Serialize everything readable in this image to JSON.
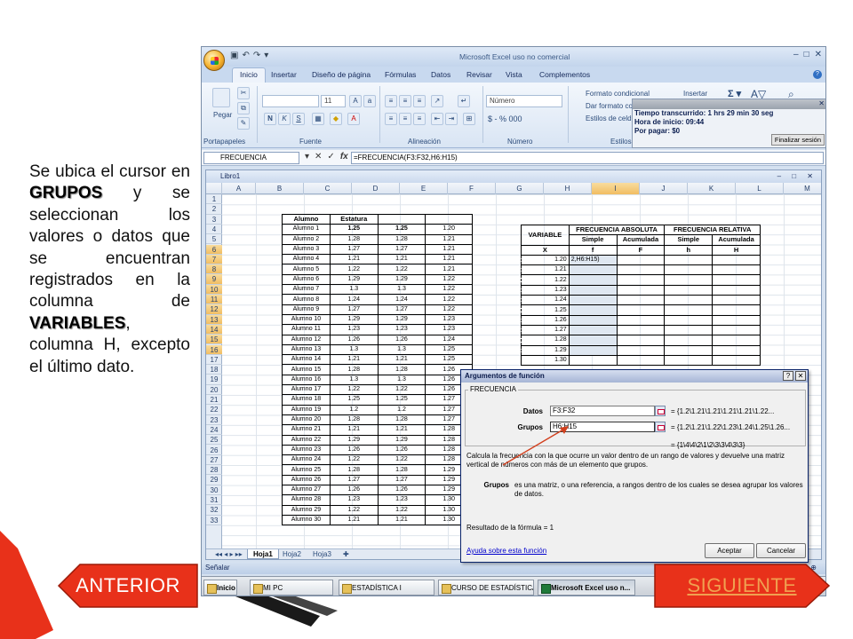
{
  "slide": {
    "segments": [
      {
        "text": "Se ubica el cursor en ",
        "bold": false
      },
      {
        "text": "GRUPOS",
        "bold": true
      },
      {
        "text": " y se seleccionan los valores o datos que se encuentran registrados en la columna de ",
        "bold": false
      },
      {
        "text": "VARIABLES",
        "bold": true
      },
      {
        "text": ", columna H, excepto el último dato.",
        "bold": false
      }
    ],
    "prev_label": "ANTERIOR",
    "next_label": "SIGUIENTE",
    "colors": {
      "accent_red": "#e8311a",
      "dark_arrow": "#1a1a1a"
    }
  },
  "excel": {
    "title": "Microsoft Excel uso no comercial",
    "tabs": [
      "Inicio",
      "Insertar",
      "Diseño de página",
      "Fórmulas",
      "Datos",
      "Revisar",
      "Vista",
      "Complementos"
    ],
    "active_tab": "Inicio",
    "ribbon": {
      "paste_label": "Pegar",
      "clipboard_group": "Portapapeles",
      "font_size": "11",
      "font_group": "Fuente",
      "bold_italic_underline": [
        "N",
        "K",
        "S"
      ],
      "alignment_group": "Alineación",
      "number_format": "Número",
      "number_group": "Número",
      "conditional_format": "Formato condicional",
      "table_format": "Dar formato co",
      "cell_styles": "Estilos de celd",
      "styles_group": "Estilos",
      "insert_label": "Insertar",
      "number_symbols": "$ - % 000"
    },
    "timer": {
      "elapsed": "Tiempo transcurrido: 1 hrs 29 min 30 seg",
      "start": "Hora de inicio: 09:44",
      "due": "Por pagar: $0",
      "end_button": "Finalizar sesión"
    },
    "name_box": "FRECUENCIA",
    "formula": "=FRECUENCIA(F3:F32,H6:H15)",
    "workbook_title": "Libro1",
    "columns": [
      "A",
      "B",
      "C",
      "D",
      "E",
      "F",
      "G",
      "H",
      "I",
      "J",
      "K",
      "L",
      "M"
    ],
    "rows": [
      "1",
      "2",
      "3",
      "4",
      "5",
      "6",
      "7",
      "8",
      "9",
      "10",
      "11",
      "12",
      "13",
      "14",
      "15",
      "16",
      "17",
      "18",
      "19",
      "20",
      "21",
      "22",
      "23",
      "24",
      "25",
      "26",
      "27",
      "28",
      "29",
      "30",
      "31",
      "32",
      "33"
    ],
    "student_header": [
      "Alumno",
      "Estatura"
    ],
    "students": [
      [
        "Alumno 1",
        "1.25",
        "1.25",
        "1.20"
      ],
      [
        "Alumno 2",
        "1.28",
        "1.28",
        "1.21"
      ],
      [
        "Alumno 3",
        "1.27",
        "1.27",
        "1.21"
      ],
      [
        "Alumno 4",
        "1.21",
        "1.21",
        "1.21"
      ],
      [
        "Alumno 5",
        "1.22",
        "1.22",
        "1.21"
      ],
      [
        "Alumno 6",
        "1.29",
        "1.29",
        "1.22"
      ],
      [
        "Alumno 7",
        "1.3",
        "1.3",
        "1.22"
      ],
      [
        "Alumno 8",
        "1.24",
        "1.24",
        "1.22"
      ],
      [
        "Alumno 9",
        "1.27",
        "1.27",
        "1.22"
      ],
      [
        "Alumno 10",
        "1.29",
        "1.29",
        "1.23"
      ],
      [
        "Alumno 11",
        "1.23",
        "1.23",
        "1.23"
      ],
      [
        "Alumno 12",
        "1.26",
        "1.26",
        "1.24"
      ],
      [
        "Alumno 13",
        "1.3",
        "1.3",
        "1.25"
      ],
      [
        "Alumno 14",
        "1.21",
        "1.21",
        "1.25"
      ],
      [
        "Alumno 15",
        "1.28",
        "1.28",
        "1.26"
      ],
      [
        "Alumno 16",
        "1.3",
        "1.3",
        "1.26"
      ],
      [
        "Alumno 17",
        "1.22",
        "1.22",
        "1.26"
      ],
      [
        "Alumno 18",
        "1.25",
        "1.25",
        "1.27"
      ],
      [
        "Alumno 19",
        "1.2",
        "1.2",
        "1.27"
      ],
      [
        "Alumno 20",
        "1.28",
        "1.28",
        "1.27"
      ],
      [
        "Alumno 21",
        "1.21",
        "1.21",
        "1.28"
      ],
      [
        "Alumno 22",
        "1.29",
        "1.29",
        "1.28"
      ],
      [
        "Alumno 23",
        "1.26",
        "1.26",
        "1.28"
      ],
      [
        "Alumno 24",
        "1.22",
        "1.22",
        "1.28"
      ],
      [
        "Alumno 25",
        "1.28",
        "1.28",
        "1.29"
      ],
      [
        "Alumno 26",
        "1.27",
        "1.27",
        "1.29"
      ],
      [
        "Alumno 27",
        "1.26",
        "1.26",
        "1.29"
      ],
      [
        "Alumno 28",
        "1.23",
        "1.23",
        "1.30"
      ],
      [
        "Alumno 29",
        "1.22",
        "1.22",
        "1.30"
      ],
      [
        "Alumno 30",
        "1.21",
        "1.21",
        "1.30"
      ]
    ],
    "freq_table": {
      "variable_header": "VARIABLE",
      "abs_header": "FRECUENCIA ABSOLUTA",
      "rel_header": "FRECUENCIA RELATIVA",
      "sub_headers": [
        "Simple",
        "Acumulada",
        "Simple",
        "Acumulada"
      ],
      "symbols": [
        "X",
        "f",
        "F",
        "h",
        "H"
      ],
      "editing_text": "2,H6:H15)",
      "variables": [
        "1.20",
        "1.21",
        "1.22",
        "1.23",
        "1.24",
        "1.25",
        "1.26",
        "1.27",
        "1.28",
        "1.29",
        "1.30"
      ]
    },
    "sheet_tabs": [
      "Hoja1",
      "Hoja2",
      "Hoja3"
    ],
    "status": "Señalar",
    "taskbar": [
      "Inicio",
      "MI PC",
      "ESTADÍSTICA I",
      "CURSO DE ESTADÍSTICA...",
      "Microsoft Excel uso n..."
    ],
    "dialog": {
      "title": "Argumentos de función",
      "function_name": "FRECUENCIA",
      "args": [
        {
          "label": "Datos",
          "input": "F3:F32",
          "value": "= {1.2\\1.21\\1.21\\1.21\\1.21\\1.22..."
        },
        {
          "label": "Grupos",
          "input": "H6:H15",
          "value": "= {1.2\\1.21\\1.22\\1.23\\1.24\\1.25\\1.26..."
        }
      ],
      "result_preview": "= {1\\4\\4\\2\\1\\2\\3\\3\\4\\3\\3}",
      "description": "Calcula la frecuencia con la que ocurre un valor dentro de un rango de valores y devuelve una matriz vertical de números con más de un elemento que grupos.",
      "help_label": "Grupos",
      "help_text": "es una matriz, o una referencia, a rangos dentro de los cuales se desea agrupar los valores de datos.",
      "result_label": "Resultado de la fórmula =",
      "result_value": "1",
      "help_link": "Ayuda sobre esta función",
      "ok": "Aceptar",
      "cancel": "Cancelar"
    }
  }
}
